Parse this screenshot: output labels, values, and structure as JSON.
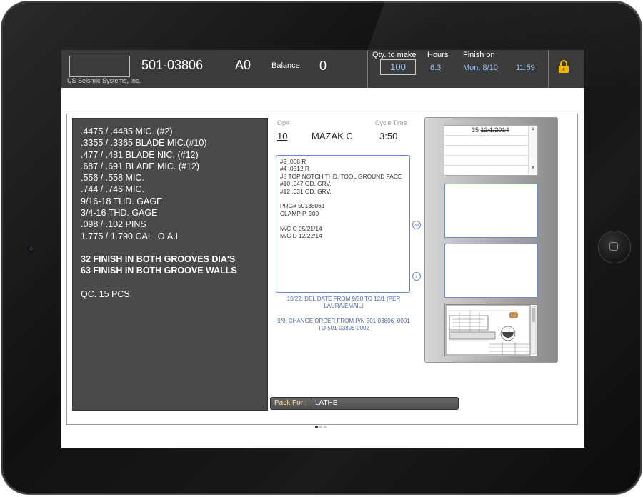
{
  "header": {
    "company": "US Seismic Systems, Inc.",
    "part_number": "501-03806",
    "revision": "A0",
    "balance_label": "Balance:",
    "balance_value": "0",
    "qty_label": "Qty. to make",
    "qty_value": "100",
    "hours_label": "Hours",
    "hours_value": "6.3",
    "finish_label": "Finish on",
    "finish_date": "Mon, 8/10",
    "finish_time": "11:59",
    "lock_icon": "lock-icon",
    "colors": {
      "bar": "#3b3b3b",
      "link": "#9fc2f0",
      "lock": "#f0b400"
    }
  },
  "notes": {
    "lines": [
      ".4475 / .4485 MIC. (#2)",
      ".3355 / .3365 BLADE MIC.(#10)",
      ".477 / .481 BLADE NIC. (#12)",
      ".687 / .691 BLADE MIC. (#12)",
      ".556 / .558 MIC.",
      ".744 / .746 MIC.",
      "9/16-18 THD. GAGE",
      "3/4-16 THD. GAGE",
      ".098 / .102 PINS",
      "1.775 / 1.790 CAL. O.A.L"
    ],
    "finish_lines": [
      "32 FINISH IN BOTH GROOVES DIA'S",
      "63 FINISH IN BOTH GROOVE WALLS"
    ],
    "qc": "QC. 15 PCS."
  },
  "operation": {
    "op_label": "Op#",
    "op_value": "10",
    "machine": "MAZAK C",
    "cycle_label": "Cycle Time",
    "cycle_value": "3:50"
  },
  "instructions": [
    "#2 .008 R",
    "#4 .0312 R",
    "#8 TOP NOTCH THD. TOOL GROUND FACE",
    "#10 .047 OD. GRV.",
    "#12 .031 OD. GRV.",
    "",
    "PRG# 50138061",
    "CLAMP P. 300",
    "",
    "M/C C 05/21/14",
    "M/C D 12/22/14"
  ],
  "memo_link_icon": "m",
  "info_link_icon": "i",
  "memos": [
    "10/22:  DEL DATE FROM 9/30 TO 12/1 (PER LAURA/EMAIL)",
    "9/9: CHANGE ORDER FROM P/N 501-03806 -0001 TO 501-03806-0002"
  ],
  "pack": {
    "label": "Pack For :",
    "value": "LATHE"
  },
  "dates": {
    "qty": "35",
    "date": "12/1/2014"
  },
  "pager": {
    "pages": 3,
    "current": 1
  }
}
